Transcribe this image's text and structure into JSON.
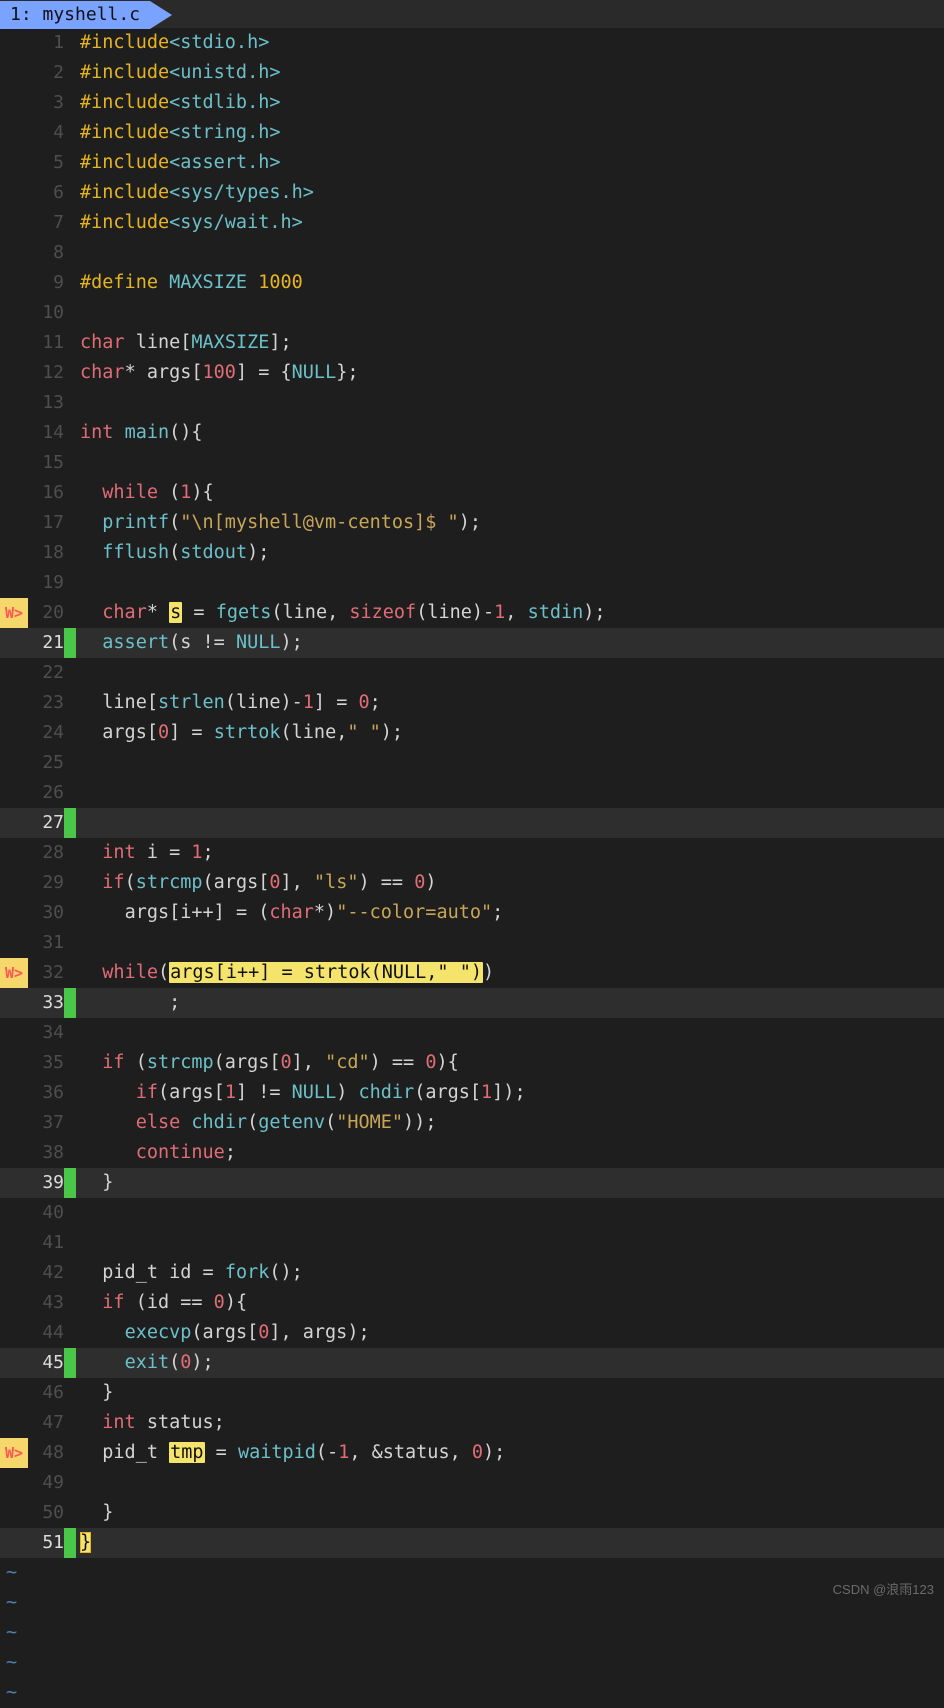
{
  "tab": {
    "label": "1: myshell.c"
  },
  "watermark": "CSDN @浪雨123",
  "lines": [
    {
      "n": "1",
      "sign": "",
      "cursor": false,
      "green": false,
      "html": "<span class='pp'>#include</span><span class='hdr'>&lt;stdio.h&gt;</span>"
    },
    {
      "n": "2",
      "sign": "",
      "cursor": false,
      "green": false,
      "html": "<span class='pp'>#include</span><span class='hdr'>&lt;unistd.h&gt;</span>"
    },
    {
      "n": "3",
      "sign": "",
      "cursor": false,
      "green": false,
      "html": "<span class='pp'>#include</span><span class='hdr'>&lt;stdlib.h&gt;</span>"
    },
    {
      "n": "4",
      "sign": "",
      "cursor": false,
      "green": false,
      "html": "<span class='pp'>#include</span><span class='hdr'>&lt;string.h&gt;</span>"
    },
    {
      "n": "5",
      "sign": "",
      "cursor": false,
      "green": false,
      "html": "<span class='pp'>#include</span><span class='hdr'>&lt;assert.h&gt;</span>"
    },
    {
      "n": "6",
      "sign": "",
      "cursor": false,
      "green": false,
      "html": "<span class='pp'>#include</span><span class='hdr'>&lt;sys/types.h&gt;</span>"
    },
    {
      "n": "7",
      "sign": "",
      "cursor": false,
      "green": false,
      "html": "<span class='pp'>#include</span><span class='hdr'>&lt;sys/wait.h&gt;</span>"
    },
    {
      "n": "8",
      "sign": "",
      "cursor": false,
      "green": false,
      "html": ""
    },
    {
      "n": "9",
      "sign": "",
      "cursor": false,
      "green": false,
      "html": "<span class='pp'>#define</span> <span class='mac'>MAXSIZE</span> <span class='num2'>1000</span>"
    },
    {
      "n": "10",
      "sign": "",
      "cursor": false,
      "green": false,
      "html": ""
    },
    {
      "n": "11",
      "sign": "",
      "cursor": false,
      "green": false,
      "html": "<span class='kwred'>char</span> <span class='id'>line[</span><span class='mac'>MAXSIZE</span><span class='id'>];</span>"
    },
    {
      "n": "12",
      "sign": "",
      "cursor": false,
      "green": false,
      "html": "<span class='kwred'>char</span><span class='id'>* args[</span><span class='numr'>100</span><span class='id'>] = {</span><span class='mac'>NULL</span><span class='id'>};</span>"
    },
    {
      "n": "13",
      "sign": "",
      "cursor": false,
      "green": false,
      "html": ""
    },
    {
      "n": "14",
      "sign": "",
      "cursor": false,
      "green": false,
      "html": "<span class='kwred'>int</span> <span class='fn'>main</span><span class='id'>(){</span>"
    },
    {
      "n": "15",
      "sign": "",
      "cursor": false,
      "green": false,
      "html": ""
    },
    {
      "n": "16",
      "sign": "",
      "cursor": false,
      "green": false,
      "html": "  <span class='kwred'>while</span> <span class='id'>(</span><span class='numr'>1</span><span class='id'>){</span>"
    },
    {
      "n": "17",
      "sign": "",
      "cursor": false,
      "green": false,
      "html": "  <span class='fn'>printf</span><span class='id'>(</span><span class='str'>\"\\n[myshell@vm-centos]$ \"</span><span class='id'>);</span>"
    },
    {
      "n": "18",
      "sign": "",
      "cursor": false,
      "green": false,
      "html": "  <span class='fn'>fflush</span><span class='id'>(</span><span class='mac'>stdout</span><span class='id'>);</span>"
    },
    {
      "n": "19",
      "sign": "",
      "cursor": false,
      "green": false,
      "html": ""
    },
    {
      "n": "20",
      "sign": "W>",
      "cursor": false,
      "green": false,
      "html": "  <span class='kwred'>char</span><span class='id'>* </span><span class='hl'>s</span><span class='id'> = </span><span class='fn'>fgets</span><span class='id'>(line, </span><span class='kwred'>sizeof</span><span class='id'>(line)-</span><span class='numr'>1</span><span class='id'>, </span><span class='mac'>stdin</span><span class='id'>);</span>"
    },
    {
      "n": "21",
      "sign": "",
      "cursor": true,
      "green": true,
      "html": "  <span class='fn'>assert</span><span class='id'>(s != </span><span class='mac'>NULL</span><span class='id'>);</span>"
    },
    {
      "n": "22",
      "sign": "",
      "cursor": false,
      "green": false,
      "html": ""
    },
    {
      "n": "23",
      "sign": "",
      "cursor": false,
      "green": false,
      "html": "  <span class='id'>line[</span><span class='fn'>strlen</span><span class='id'>(line)-</span><span class='numr'>1</span><span class='id'>] = </span><span class='numr'>0</span><span class='id'>;</span>"
    },
    {
      "n": "24",
      "sign": "",
      "cursor": false,
      "green": false,
      "html": "  <span class='id'>args[</span><span class='numr'>0</span><span class='id'>] = </span><span class='fn'>strtok</span><span class='id'>(line,</span><span class='str'>\" \"</span><span class='id'>);</span>"
    },
    {
      "n": "25",
      "sign": "",
      "cursor": false,
      "green": false,
      "html": ""
    },
    {
      "n": "26",
      "sign": "",
      "cursor": false,
      "green": false,
      "html": ""
    },
    {
      "n": "27",
      "sign": "",
      "cursor": true,
      "green": true,
      "html": ""
    },
    {
      "n": "28",
      "sign": "",
      "cursor": false,
      "green": false,
      "html": "  <span class='kwred'>int</span> <span class='id'>i = </span><span class='numr'>1</span><span class='id'>;</span>"
    },
    {
      "n": "29",
      "sign": "",
      "cursor": false,
      "green": false,
      "html": "  <span class='kwred'>if</span><span class='id'>(</span><span class='fn'>strcmp</span><span class='id'>(args[</span><span class='numr'>0</span><span class='id'>], </span><span class='str'>\"ls\"</span><span class='id'>) == </span><span class='numr'>0</span><span class='id'>)</span>"
    },
    {
      "n": "30",
      "sign": "",
      "cursor": false,
      "green": false,
      "html": "    <span class='id'>args[i++] = (</span><span class='kwred'>char</span><span class='id'>*)</span><span class='str'>\"--color=auto\"</span><span class='id'>;</span>"
    },
    {
      "n": "31",
      "sign": "",
      "cursor": false,
      "green": false,
      "html": ""
    },
    {
      "n": "32",
      "sign": "W>",
      "cursor": false,
      "green": false,
      "html": "  <span class='kwred'>while</span><span class='id'>(</span><span class='hl'>args[i++] = strtok(NULL,\" \")</span><span class='id'>)</span>"
    },
    {
      "n": "33",
      "sign": "",
      "cursor": true,
      "green": true,
      "html": "        <span class='id'>;</span>"
    },
    {
      "n": "34",
      "sign": "",
      "cursor": false,
      "green": false,
      "html": ""
    },
    {
      "n": "35",
      "sign": "",
      "cursor": false,
      "green": false,
      "html": "  <span class='kwred'>if</span> <span class='id'>(</span><span class='fn'>strcmp</span><span class='id'>(args[</span><span class='numr'>0</span><span class='id'>], </span><span class='str'>\"cd\"</span><span class='id'>) == </span><span class='numr'>0</span><span class='id'>){</span>"
    },
    {
      "n": "36",
      "sign": "",
      "cursor": false,
      "green": false,
      "html": "     <span class='kwred'>if</span><span class='id'>(args[</span><span class='numr'>1</span><span class='id'>] != </span><span class='mac'>NULL</span><span class='id'>) </span><span class='fn'>chdir</span><span class='id'>(args[</span><span class='numr'>1</span><span class='id'>]);</span>"
    },
    {
      "n": "37",
      "sign": "",
      "cursor": false,
      "green": false,
      "html": "     <span class='kwred'>else</span> <span class='fn'>chdir</span><span class='id'>(</span><span class='fn'>getenv</span><span class='id'>(</span><span class='str'>\"HOME\"</span><span class='id'>));</span>"
    },
    {
      "n": "38",
      "sign": "",
      "cursor": false,
      "green": false,
      "html": "     <span class='kwred'>continue</span><span class='id'>;</span>"
    },
    {
      "n": "39",
      "sign": "",
      "cursor": true,
      "green": true,
      "html": "  <span class='id'>}</span>"
    },
    {
      "n": "40",
      "sign": "",
      "cursor": false,
      "green": false,
      "html": ""
    },
    {
      "n": "41",
      "sign": "",
      "cursor": false,
      "green": false,
      "html": ""
    },
    {
      "n": "42",
      "sign": "",
      "cursor": false,
      "green": false,
      "html": "  <span class='id'>pid_t id = </span><span class='fn'>fork</span><span class='id'>();</span>"
    },
    {
      "n": "43",
      "sign": "",
      "cursor": false,
      "green": false,
      "html": "  <span class='kwred'>if</span> <span class='id'>(id == </span><span class='numr'>0</span><span class='id'>){</span>"
    },
    {
      "n": "44",
      "sign": "",
      "cursor": false,
      "green": false,
      "html": "    <span class='fn'>execvp</span><span class='id'>(args[</span><span class='numr'>0</span><span class='id'>], args);</span>"
    },
    {
      "n": "45",
      "sign": "",
      "cursor": true,
      "green": true,
      "html": "    <span class='fn'>exit</span><span class='id'>(</span><span class='numr'>0</span><span class='id'>);</span>"
    },
    {
      "n": "46",
      "sign": "",
      "cursor": false,
      "green": false,
      "html": "  <span class='id'>}</span>"
    },
    {
      "n": "47",
      "sign": "",
      "cursor": false,
      "green": false,
      "html": "  <span class='kwred'>int</span> <span class='id'>status;</span>"
    },
    {
      "n": "48",
      "sign": "W>",
      "cursor": false,
      "green": false,
      "html": "  <span class='id'>pid_t </span><span class='hl'>tmp</span><span class='id'> = </span><span class='fn'>waitpid</span><span class='id'>(-</span><span class='numr'>1</span><span class='id'>, &amp;status, </span><span class='numr'>0</span><span class='id'>);</span>"
    },
    {
      "n": "49",
      "sign": "",
      "cursor": false,
      "green": false,
      "html": ""
    },
    {
      "n": "50",
      "sign": "",
      "cursor": false,
      "green": false,
      "html": "  <span class='id'>}</span>"
    },
    {
      "n": "51",
      "sign": "",
      "cursor": true,
      "green": true,
      "html": "<span class='hlcur'>}</span>"
    }
  ],
  "tildes": 5
}
